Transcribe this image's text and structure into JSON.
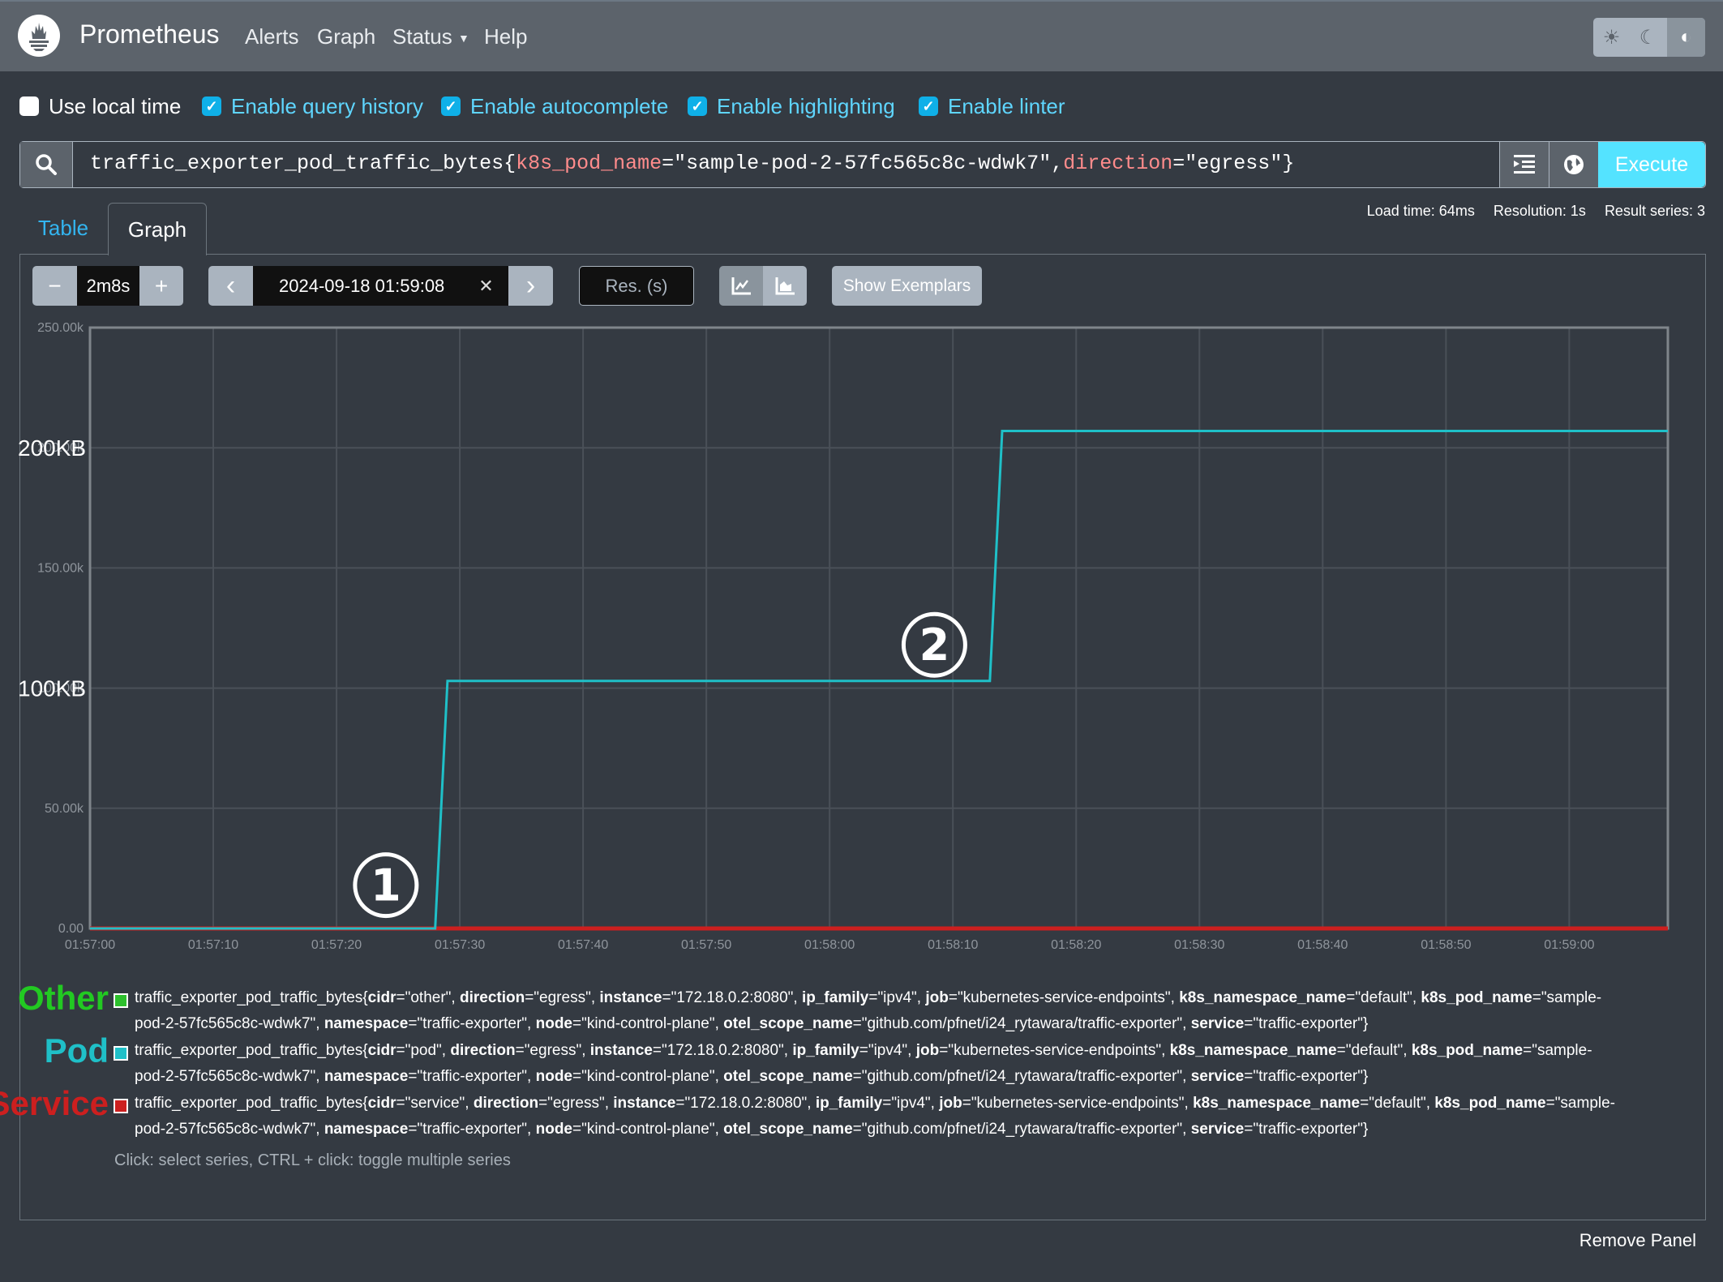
{
  "navbar": {
    "brand": "Prometheus",
    "items": [
      {
        "label": "Alerts"
      },
      {
        "label": "Graph"
      },
      {
        "label": "Status",
        "has_dropdown": true
      },
      {
        "label": "Help"
      }
    ],
    "theme_buttons": [
      {
        "icon": "sun-icon",
        "glyph": "☀"
      },
      {
        "icon": "moon-icon",
        "glyph": "☾"
      },
      {
        "icon": "contrast-icon",
        "glyph": "◐",
        "active": true
      }
    ]
  },
  "options": [
    {
      "label": "Use local time",
      "checked": false
    },
    {
      "label": "Enable query history",
      "checked": true
    },
    {
      "label": "Enable autocomplete",
      "checked": true
    },
    {
      "label": "Enable highlighting",
      "checked": true
    },
    {
      "label": "Enable linter",
      "checked": true
    }
  ],
  "query": {
    "metric": "traffic_exporter_pod_traffic_bytes",
    "open": "{",
    "label1": "k8s_pod_name",
    "eq1": "=",
    "val1": "\"sample-pod-2-57fc565c8c-wdwk7\"",
    "comma": ",",
    "label2": "direction",
    "eq2": "=",
    "val2": "\"egress\"",
    "close": "}",
    "execute_label": "Execute"
  },
  "stats": {
    "load_time": "Load time: 64ms",
    "resolution": "Resolution: 1s",
    "result_series": "Result series: 3"
  },
  "tabs": [
    {
      "label": "Table",
      "active": false
    },
    {
      "label": "Graph",
      "active": true
    }
  ],
  "controls": {
    "range_minus": "−",
    "range_value": "2m8s",
    "range_plus": "+",
    "prev": "‹",
    "end_time": "2024-09-18 01:59:08",
    "clear": "✕",
    "next": "›",
    "resolution_placeholder": "Res. (s)",
    "show_exemplars": "Show Exemplars"
  },
  "chart_data": {
    "type": "line",
    "x_ticks": [
      "01:57:00",
      "01:57:10",
      "01:57:20",
      "01:57:30",
      "01:57:40",
      "01:57:50",
      "01:58:00",
      "01:58:10",
      "01:58:20",
      "01:58:30",
      "01:58:40",
      "01:58:50",
      "01:59:00"
    ],
    "x_range_seconds": [
      0,
      128
    ],
    "x_start": "01:57:00",
    "y_ticks": [
      "0.00",
      "50.00k",
      "100.00k",
      "150.00k",
      "200.00k",
      "250.00k"
    ],
    "y_tick_values": [
      0,
      50000,
      100000,
      150000,
      200000,
      250000
    ],
    "ylim": [
      0,
      250000
    ],
    "grid": true,
    "overlay_labels": [
      {
        "text": "200KB",
        "value": 200000
      },
      {
        "text": "100KB",
        "value": 100000
      }
    ],
    "annotations": [
      {
        "text": "①",
        "t": 24,
        "value": 18000
      },
      {
        "text": "②",
        "t": 68.5,
        "value": 118000
      }
    ],
    "series": [
      {
        "name": "other",
        "color": "#2dc02d",
        "points": [
          [
            0,
            0
          ],
          [
            128,
            0
          ]
        ]
      },
      {
        "name": "pod",
        "color": "#1fc0c8",
        "points": [
          [
            0,
            0
          ],
          [
            28,
            0
          ],
          [
            29,
            103000
          ],
          [
            73,
            103000
          ],
          [
            74,
            207000
          ],
          [
            128,
            207000
          ]
        ]
      },
      {
        "name": "service",
        "color": "#cc1f1f",
        "points": [
          [
            0,
            0
          ],
          [
            128,
            0
          ]
        ]
      }
    ]
  },
  "legend": [
    {
      "tag": "Other",
      "tag_color": "#22c922",
      "swatch_color": "#2dc02d",
      "metric": "traffic_exporter_pod_traffic_bytes",
      "labels": [
        [
          "cidr",
          "\"other\""
        ],
        [
          "direction",
          "\"egress\""
        ],
        [
          "instance",
          "\"172.18.0.2:8080\""
        ],
        [
          "ip_family",
          "\"ipv4\""
        ],
        [
          "job",
          "\"kubernetes-service-endpoints\""
        ],
        [
          "k8s_namespace_name",
          "\"default\""
        ],
        [
          "k8s_pod_name",
          "\"sample-pod-2-57fc565c8c-wdwk7\""
        ],
        [
          "namespace",
          "\"traffic-exporter\""
        ],
        [
          "node",
          "\"kind-control-plane\""
        ],
        [
          "otel_scope_name",
          "\"github.com/pfnet/i24_rytawara/traffic-exporter\""
        ],
        [
          "service",
          "\"traffic-exporter\""
        ]
      ]
    },
    {
      "tag": "Pod",
      "tag_color": "#1fc0c8",
      "swatch_color": "#1fc0c8",
      "metric": "traffic_exporter_pod_traffic_bytes",
      "labels": [
        [
          "cidr",
          "\"pod\""
        ],
        [
          "direction",
          "\"egress\""
        ],
        [
          "instance",
          "\"172.18.0.2:8080\""
        ],
        [
          "ip_family",
          "\"ipv4\""
        ],
        [
          "job",
          "\"kubernetes-service-endpoints\""
        ],
        [
          "k8s_namespace_name",
          "\"default\""
        ],
        [
          "k8s_pod_name",
          "\"sample-pod-2-57fc565c8c-wdwk7\""
        ],
        [
          "namespace",
          "\"traffic-exporter\""
        ],
        [
          "node",
          "\"kind-control-plane\""
        ],
        [
          "otel_scope_name",
          "\"github.com/pfnet/i24_rytawara/traffic-exporter\""
        ],
        [
          "service",
          "\"traffic-exporter\""
        ]
      ]
    },
    {
      "tag": "Service",
      "tag_color": "#cc1f1f",
      "swatch_color": "#cc1f1f",
      "metric": "traffic_exporter_pod_traffic_bytes",
      "labels": [
        [
          "cidr",
          "\"service\""
        ],
        [
          "direction",
          "\"egress\""
        ],
        [
          "instance",
          "\"172.18.0.2:8080\""
        ],
        [
          "ip_family",
          "\"ipv4\""
        ],
        [
          "job",
          "\"kubernetes-service-endpoints\""
        ],
        [
          "k8s_namespace_name",
          "\"default\""
        ],
        [
          "k8s_pod_name",
          "\"sample-pod-2-57fc565c8c-wdwk7\""
        ],
        [
          "namespace",
          "\"traffic-exporter\""
        ],
        [
          "node",
          "\"kind-control-plane\""
        ],
        [
          "otel_scope_name",
          "\"github.com/pfnet/i24_rytawara/traffic-exporter\""
        ],
        [
          "service",
          "\"traffic-exporter\""
        ]
      ]
    }
  ],
  "hint": "Click: select series, CTRL + click: toggle multiple series",
  "remove_panel": "Remove Panel"
}
